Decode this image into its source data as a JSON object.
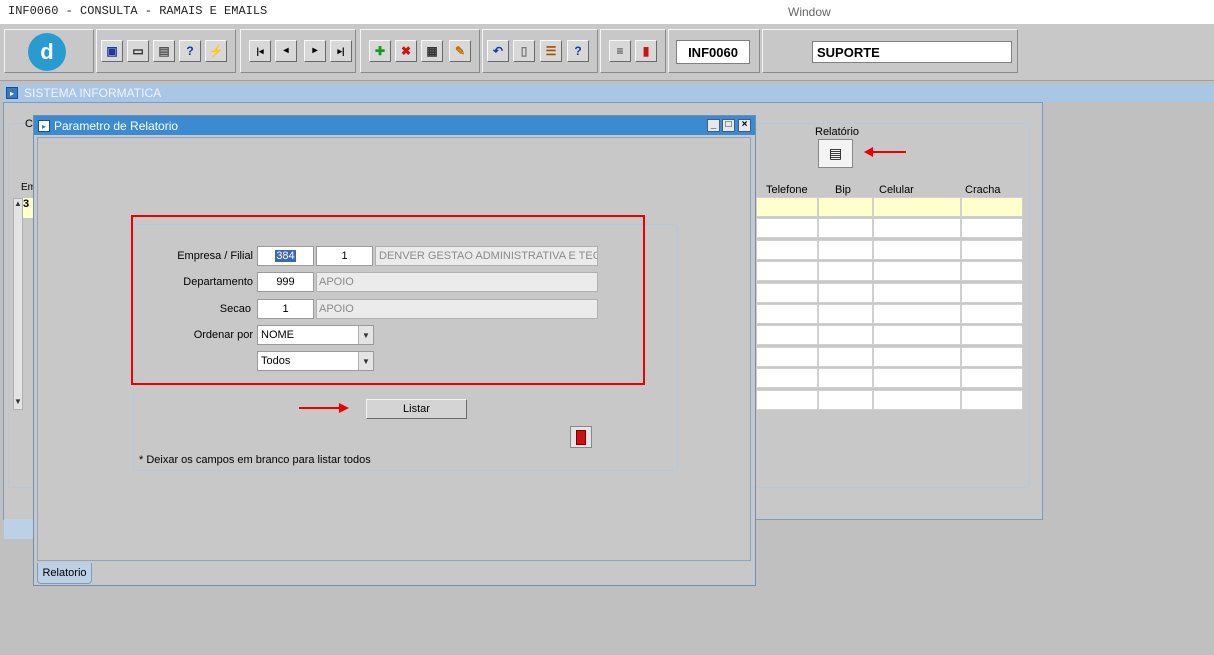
{
  "title_bar": {
    "app_title": "INF0060 - CONSULTA - RAMAIS E EMAILS",
    "window_menu": "Window"
  },
  "toolbar": {
    "logo": "d",
    "form_code": "INF0060",
    "user_field": "SUPORTE",
    "buttons": [
      {
        "name": "save-icon",
        "glyph": "▣"
      },
      {
        "name": "print-preview-icon",
        "glyph": "▭"
      },
      {
        "name": "printer-icon",
        "glyph": "▤"
      },
      {
        "name": "query-icon",
        "glyph": "?"
      },
      {
        "name": "execute-query-icon",
        "glyph": "⚡"
      },
      {
        "name": "first-record-icon",
        "glyph": "|◂"
      },
      {
        "name": "previous-record-icon",
        "glyph": "◂"
      },
      {
        "name": "next-record-icon",
        "glyph": "▸"
      },
      {
        "name": "last-record-icon",
        "glyph": "▸|"
      },
      {
        "name": "insert-record-icon",
        "glyph": "✚"
      },
      {
        "name": "delete-record-icon",
        "glyph": "✖"
      },
      {
        "name": "duplicate-record-icon",
        "glyph": "▦"
      },
      {
        "name": "edit-record-icon",
        "glyph": "✎"
      },
      {
        "name": "undo-icon",
        "glyph": "↶"
      },
      {
        "name": "clipboard-icon",
        "glyph": "▯"
      },
      {
        "name": "options-icon",
        "glyph": "☰"
      },
      {
        "name": "help-icon",
        "glyph": "?"
      },
      {
        "name": "menu-icon",
        "glyph": "≡"
      },
      {
        "name": "exit-icon",
        "glyph": "▮"
      }
    ]
  },
  "base_window": {
    "title": "SISTEMA INFORMATICA",
    "frame_label_letter": "C",
    "column_letters": "Em",
    "row_value_letter": "3",
    "relatorio_label": "Relatório",
    "columns": [
      "Telefone",
      "Bip",
      "Celular",
      "Cracha"
    ]
  },
  "dialog": {
    "title": "Parametro de Relatorio",
    "empresa_label": "Empresa / Filial",
    "empresa_value": "384",
    "filial_value": "1",
    "empresa_desc": "DENVER GESTAO ADMINISTRATIVA E TECNOLOGIA",
    "departamento_label": "Departamento",
    "departamento_value": "999",
    "departamento_desc": "APOIO",
    "secao_label": "Secao",
    "secao_value": "1",
    "secao_desc": "APOIO",
    "ordenar_label": "Ordenar por",
    "ordenar_value": "NOME",
    "filtro_value": "Todos",
    "listar_button": "Listar",
    "hint": "* Deixar os campos em branco para listar todos",
    "tab_label": "Relatorio"
  },
  "colors": {
    "annotation_red": "#ee0000",
    "dialog_titlebar": "#3c8ad0",
    "highlight_row": "#ffffcc"
  }
}
